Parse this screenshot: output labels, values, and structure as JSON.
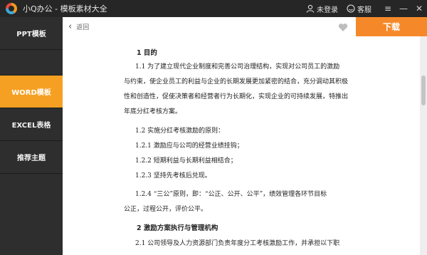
{
  "app": {
    "title": "小Q办公 - 模板素材大全",
    "login_label": "未登录",
    "service_label": "客服",
    "window_controls": {
      "menu": "≡",
      "minimize": "—",
      "close": "✕"
    }
  },
  "sidebar": {
    "items": [
      {
        "label": "PPT模板",
        "active": false
      },
      {
        "label": "WORD模板",
        "active": true
      },
      {
        "label": "EXCEL表格",
        "active": false
      },
      {
        "label": "推荐主题",
        "active": false
      }
    ]
  },
  "toolbar": {
    "back_label": "返回",
    "download_label": "下载"
  },
  "document": {
    "lines": [
      "1  目的",
      "1.1  为了建立现代企业制度和完善公司治理结构，实现对公司员工的激励",
      "与约束，使企业员工的利益与企业的长期发展更加紧密的结合，充分调动其积极",
      "性和创造性，促使决策者和经营者行为长期化，实现企业的可持续发展，特推出",
      "年底分红考核方案。",
      "1.2  实施分红考核激励的原则：",
      "1.2.1  激励应与公司的经营业绩挂钩；",
      "1.2.2  短期利益与长期利益相结合；",
      "1.2.3  坚持先考核后兑现。",
      "1.2.4  “三公”原则，即：“公正、公开、公平”，绩效管理各环节目标",
      "公正，过程公开，评价公平。",
      "2  激励方案执行与管理机构",
      "2.1  公司领导及人力资源部门负责年度分工考核激励工作，并承担以下职"
    ]
  },
  "colors": {
    "accent": "#f5a023",
    "download": "#f5892a",
    "titlebar": "#262626",
    "sidebar": "#2e2e2e"
  }
}
